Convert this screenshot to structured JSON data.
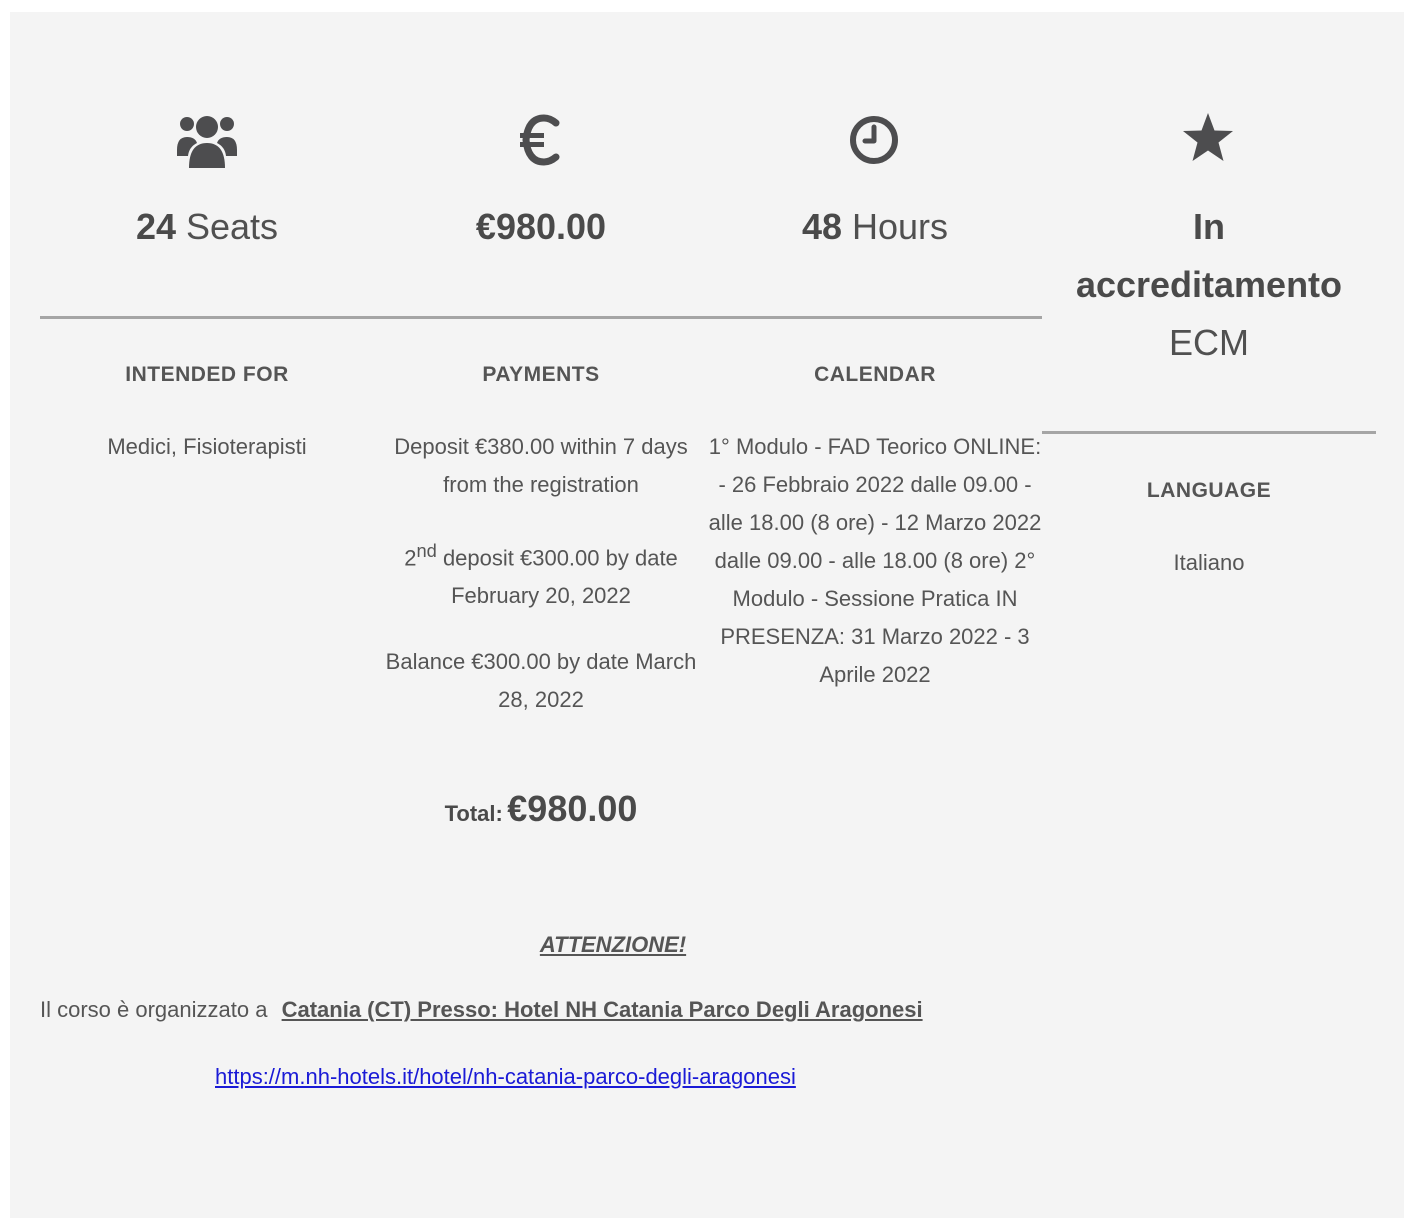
{
  "stats": {
    "seats": {
      "icon": "group-icon",
      "bold": "24",
      "text": " Seats"
    },
    "price": {
      "icon": "euro-icon",
      "bold": "€980.00",
      "text": ""
    },
    "hours": {
      "icon": "clock-icon",
      "bold": "48",
      "text": " Hours"
    },
    "accreditation": {
      "icon": "star-icon",
      "bold_line1": "In",
      "bold_line2": "accreditamento",
      "text": "ECM"
    }
  },
  "intended_for": {
    "label": "INTENDED FOR",
    "value": "Medici, Fisioterapisti"
  },
  "payments": {
    "label": "PAYMENTS",
    "deposit": "Deposit €380.00 within 7 days from the registration",
    "second_deposit_prefix": "2",
    "second_deposit_sup": "nd",
    "second_deposit_text": " deposit €300.00 by date February 20, 2022",
    "balance": "Balance €300.00 by date March 28, 2022",
    "total_label": "Total:",
    "total_value": "€980.00"
  },
  "calendar": {
    "label": "CALENDAR",
    "value": "1° Modulo - FAD Teorico ONLINE: - 26 Febbraio 2022 dalle 09.00 - alle 18.00 (8 ore) - 12 Marzo 2022 dalle 09.00 - alle 18.00 (8 ore) 2° Modulo - Sessione Pratica IN PRESENZA: 31 Marzo 2022 - 3 Aprile 2022"
  },
  "language": {
    "label": "LANGUAGE",
    "value": "Italiano"
  },
  "notice": {
    "title": "ATTENZIONE!",
    "location_prefix": "Il corso è organizzato a",
    "location_link": "Catania (CT) Presso: Hotel NH Catania Parco Degli Aragonesi ",
    "url": "https://m.nh-hotels.it/hotel/nh-catania-parco-degli-aragonesi "
  }
}
